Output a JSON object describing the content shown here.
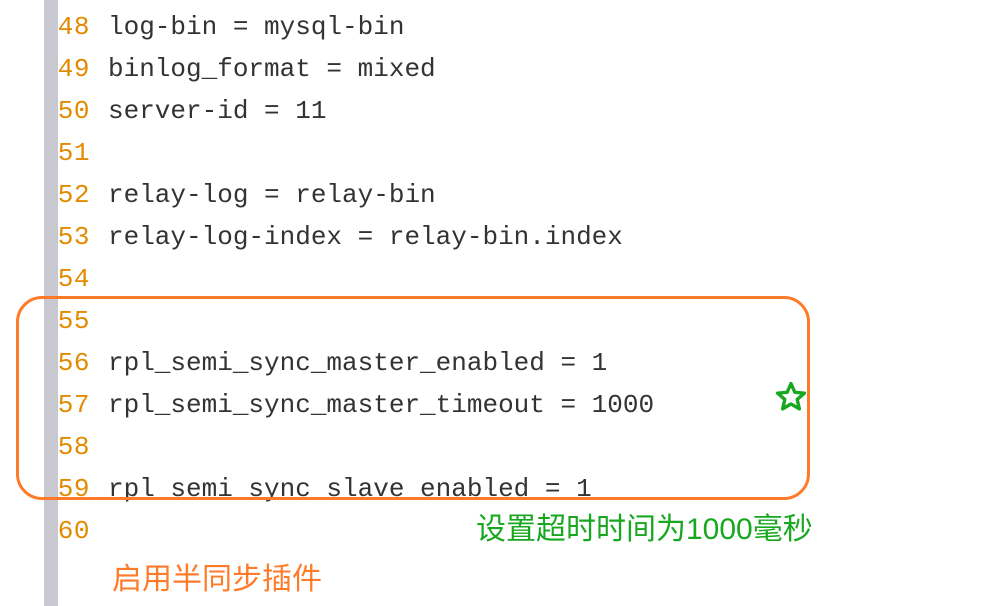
{
  "code_lines": [
    {
      "n": "48",
      "text": "log-bin = mysql-bin"
    },
    {
      "n": "49",
      "text": "binlog_format = mixed"
    },
    {
      "n": "50",
      "text": "server-id = 11"
    },
    {
      "n": "51",
      "text": ""
    },
    {
      "n": "52",
      "text": "relay-log = relay-bin"
    },
    {
      "n": "53",
      "text": "relay-log-index = relay-bin.index"
    },
    {
      "n": "54",
      "text": ""
    },
    {
      "n": "55",
      "text": ""
    },
    {
      "n": "56",
      "text": "rpl_semi_sync_master_enabled = 1"
    },
    {
      "n": "57",
      "text": "rpl_semi_sync_master_timeout = 1000"
    },
    {
      "n": "58",
      "text": ""
    },
    {
      "n": "59",
      "text": "rpl_semi_sync_slave_enabled = 1"
    },
    {
      "n": "60",
      "text": ""
    }
  ],
  "annotations": {
    "green": "设置超时时间为1000毫秒",
    "orange": "启用半同步插件"
  },
  "colors": {
    "line_number": "#e28b00",
    "code_text": "#333333",
    "highlight_border": "#ff7a29",
    "annot_green": "#18a820",
    "annot_orange": "#ff7a29"
  }
}
